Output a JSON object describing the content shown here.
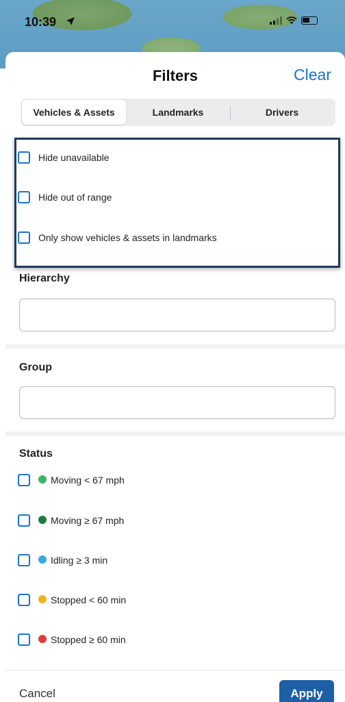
{
  "status_bar": {
    "time": "10:39"
  },
  "header": {
    "title": "Filters",
    "clear_label": "Clear"
  },
  "tabs": [
    {
      "label": "Vehicles & Assets",
      "active": true
    },
    {
      "label": "Landmarks",
      "active": false
    },
    {
      "label": "Drivers",
      "active": false
    }
  ],
  "availability_options": [
    {
      "label": "Hide unavailable",
      "checked": false
    },
    {
      "label": "Hide out of range",
      "checked": false
    },
    {
      "label": "Only show vehicles & assets in landmarks",
      "checked": false
    }
  ],
  "hierarchy": {
    "label": "Hierarchy",
    "value": ""
  },
  "group": {
    "label": "Group",
    "value": ""
  },
  "status": {
    "label": "Status",
    "items": [
      {
        "label": "Moving < 67 mph",
        "color": "#3cb46a",
        "checked": false
      },
      {
        "label": "Moving ≥ 67 mph",
        "color": "#1e7a3c",
        "checked": false
      },
      {
        "label": "Idling ≥ 3 min",
        "color": "#3aa7d8",
        "checked": false
      },
      {
        "label": "Stopped < 60 min",
        "color": "#f2b21e",
        "checked": false
      },
      {
        "label": "Stopped ≥ 60 min",
        "color": "#e23b3b",
        "checked": false
      }
    ]
  },
  "footer": {
    "cancel_label": "Cancel",
    "apply_label": "Apply"
  },
  "colors": {
    "accent": "#1a73c9",
    "apply_bg": "#1f5fa6",
    "highlight_border": "#1f3a5f"
  }
}
